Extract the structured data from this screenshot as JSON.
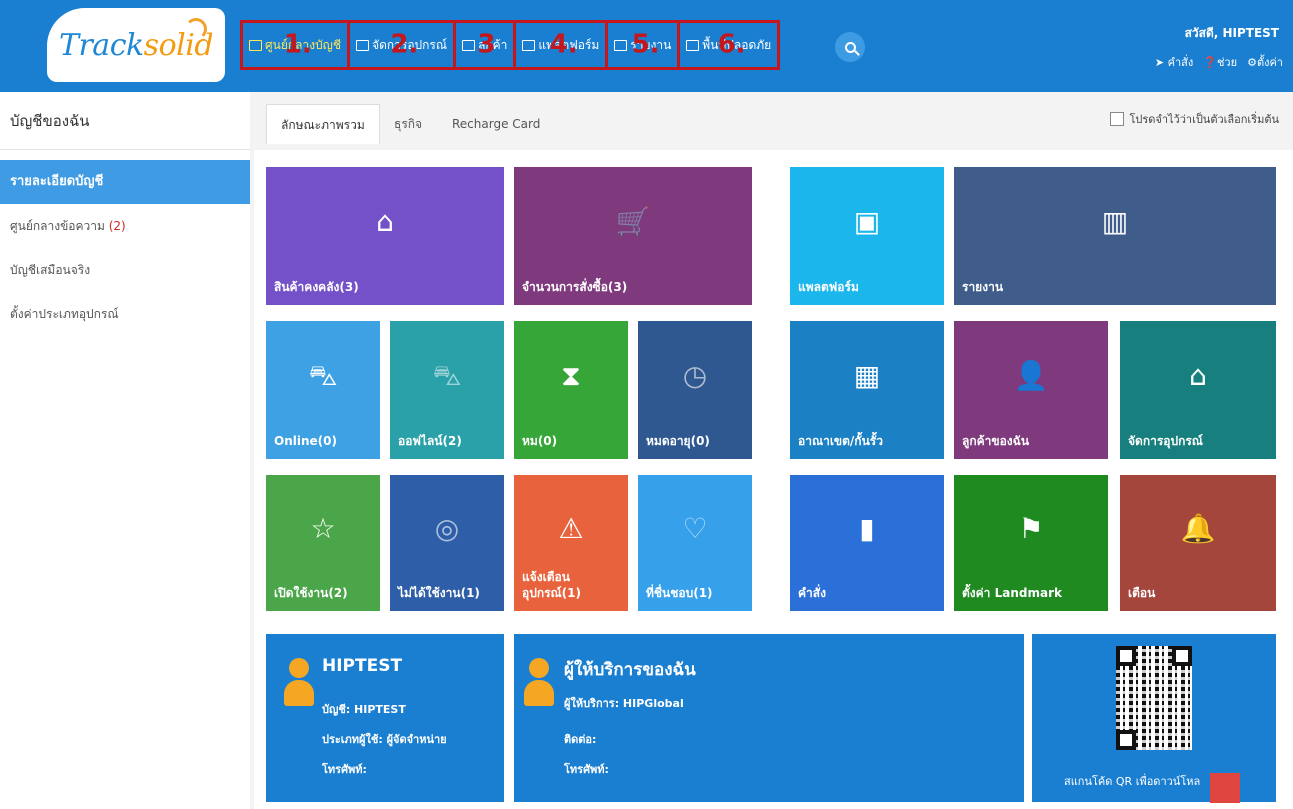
{
  "colors": {
    "header": "#1a7fd1",
    "nav_highlight": "#c3171d",
    "active_nav_text": "#ffe75a",
    "sidebar_active": "#3f9be4"
  },
  "logo": {
    "part1": "Track",
    "part2": "solid"
  },
  "nav": [
    {
      "label": "ศูนย์กลางบัญชี",
      "number": "1.",
      "icon": "account-center-icon"
    },
    {
      "label": "จัดการอุปกรณ์",
      "number": "2.",
      "icon": "device-icon"
    },
    {
      "label": "ลูกค้า",
      "number": "3",
      "icon": "customers-icon"
    },
    {
      "label": "แพลตฟอร์ม",
      "number": "4.",
      "icon": "map-icon"
    },
    {
      "label": "รายงาน",
      "number": "5.",
      "icon": "report-icon"
    },
    {
      "label": "พื้นที่ปลอดภัย",
      "number": "6.",
      "icon": "geofence-icon"
    }
  ],
  "header": {
    "greeting": "สวัสดี,  HIPTEST",
    "tools": [
      "คำสั่ง",
      "ช่วย",
      "ตั้งค่า"
    ]
  },
  "sidebar": {
    "title": "บัญชีของฉัน",
    "items": [
      {
        "label": "รายละเอียดบัญชี"
      },
      {
        "label": "ศูนย์กลางข้อความ",
        "count": "(2)"
      },
      {
        "label": "บัญชีเสมือนจริง"
      },
      {
        "label": "ตั้งค่าประเภทอุปกรณ์"
      }
    ]
  },
  "tabs": [
    "ลักษณะภาพรวม",
    "ธุรกิจ",
    "Recharge Card"
  ],
  "remember_label": "โปรดจำไว้ว่าเป็นตัวเลือกเริ่มต้น",
  "tiles": {
    "inventory": "สินค้าคงคลัง(3)",
    "orders": "จำนวนการสั่งซื้อ(3)",
    "platform": "แพลตฟอร์ม",
    "report": "รายงาน",
    "online": "Online(0)",
    "offline": "ออฟไลน์(2)",
    "expired": "หม(0)",
    "expiring": "หมดอายุ(0)",
    "geofence": "อาณาเขต/กั้นรั้ว",
    "my_customers": "ลูกค้าของฉัน",
    "device_mgmt": "จัดการอุปกรณ์",
    "activated": "เปิดใช้งาน(2)",
    "inactive": "ไม่ได้ใช้งาน(1)",
    "alert_line1": "แจ้งเตือน",
    "alert_line2": "อุปกรณ์(1)",
    "favorites": "ที่ชื่นชอบ(1)",
    "command": "คำสั่ง",
    "landmark": "ตั้งค่า Landmark",
    "alarm": "เตือน"
  },
  "account_panel": {
    "title": "HIPTEST",
    "account_label": "บัญชี: HIPTEST",
    "user_type_label": "ประเภทผู้ใช้: ผู้จัดจำหน่าย",
    "phone_label": "โทรศัพท์:"
  },
  "provider_panel": {
    "title": "ผู้ให้บริการของฉัน",
    "provider_label": "ผู้ให้บริการ: HIPGlobal",
    "contact_label": "ติดต่อ:",
    "phone_label": "โทรศัพท์:"
  },
  "qr_caption": "สแกนโค้ด QR เพื่อดาวน์โหล"
}
